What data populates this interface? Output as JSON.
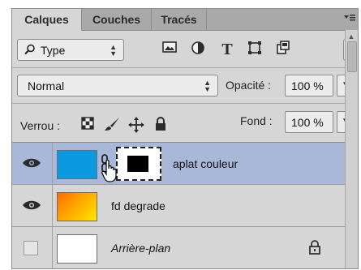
{
  "tabs": [
    {
      "label": "Calques",
      "active": true
    },
    {
      "label": "Couches",
      "active": false
    },
    {
      "label": "Tracés",
      "active": false
    }
  ],
  "filter": {
    "search_icon": "search-icon",
    "kind_label": "Type",
    "icons": [
      "image-filter-icon",
      "adjustment-filter-icon",
      "type-filter-icon",
      "shape-filter-icon",
      "smart-object-filter-icon"
    ]
  },
  "blend": {
    "mode": "Normal",
    "opacity_label": "Opacité :",
    "opacity_value": "100 %"
  },
  "lock": {
    "label": "Verrou :",
    "icons": [
      "lock-transparent-pixels-icon",
      "lock-image-pixels-icon",
      "lock-position-icon",
      "lock-all-icon"
    ],
    "fill_label": "Fond :",
    "fill_value": "100 %"
  },
  "layers": [
    {
      "name": "aplat couleur",
      "visible": true,
      "selected": true,
      "thumb_color": "#0b9ae0",
      "has_mask": true
    },
    {
      "name": "fd degrade",
      "visible": true,
      "selected": false,
      "gradient": [
        "#ff8c00",
        "#ffe600"
      ]
    },
    {
      "name": "Arrière-plan",
      "visible": false,
      "selected": false,
      "thumb_color": "#ffffff",
      "italic": true,
      "locked": true
    }
  ],
  "colors": {
    "selected_row": "#a9b8d9",
    "panel_bg": "#d6d6d6"
  }
}
